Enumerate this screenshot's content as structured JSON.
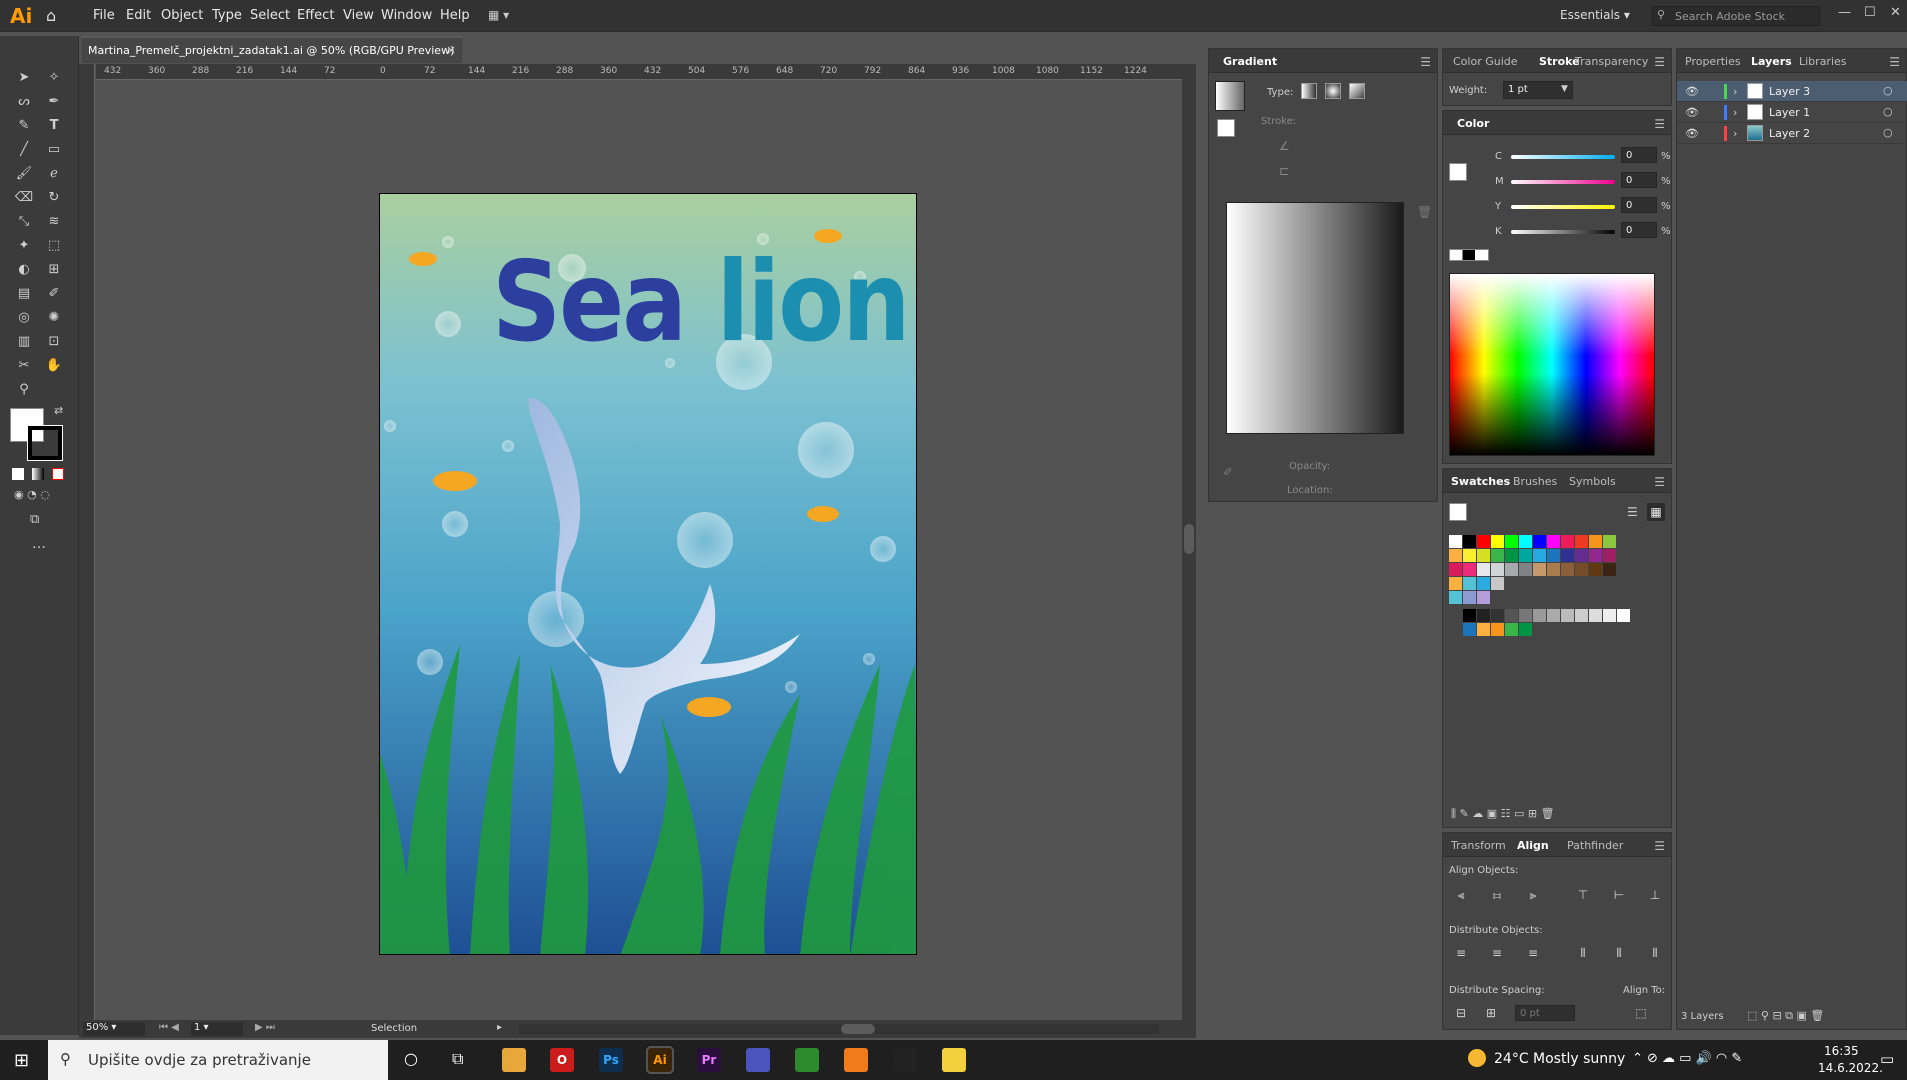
{
  "app": {
    "logo": "Ai",
    "menu": [
      "File",
      "Edit",
      "Object",
      "Type",
      "Select",
      "Effect",
      "View",
      "Window",
      "Help"
    ],
    "workspace": "Essentials",
    "search_placeholder": "Search Adobe Stock"
  },
  "document": {
    "tab_title": "Martina_Premelč_projektni_zadatak1.ai @ 50% (RGB/GPU Preview)",
    "close": "×"
  },
  "ruler": {
    "ticks": [
      "432",
      "360",
      "288",
      "216",
      "144",
      "72",
      "0",
      "72",
      "144",
      "216",
      "288",
      "360",
      "432",
      "504",
      "576",
      "648",
      "720",
      "792",
      "864",
      "936",
      "1008",
      "1080",
      "1152",
      "1224"
    ]
  },
  "artwork": {
    "title_part1": "Sea",
    "title_part2": "lion",
    "colors": {
      "water_top": "#a9cf9f",
      "water_mid": "#4aa3c9",
      "water_bottom": "#1e4f94",
      "seaweed": "#1f9a3e",
      "fish": "#f5a623",
      "sealion": "#d9e6f5"
    }
  },
  "status": {
    "zoom": "50%",
    "page": "1",
    "mode": "Selection"
  },
  "gradient_panel": {
    "title": "Gradient",
    "type_label": "Type:",
    "stroke_label": "Stroke:",
    "opacity_label": "Opacity:",
    "location_label": "Location:"
  },
  "stroke_panel": {
    "tabs": [
      "Color Guide",
      "Stroke",
      "Transparency"
    ],
    "weight_label": "Weight:",
    "weight_value": "1 pt"
  },
  "color_panel": {
    "title": "Color",
    "channels": [
      {
        "name": "C",
        "value": "0",
        "color": "#00aeef"
      },
      {
        "name": "M",
        "value": "0",
        "color": "#ec008c"
      },
      {
        "name": "Y",
        "value": "0",
        "color": "#fff200"
      },
      {
        "name": "K",
        "value": "0",
        "color": "#000000"
      }
    ],
    "unit": "%"
  },
  "swatches_panel": {
    "tabs": [
      "Swatches",
      "Brushes",
      "Symbols"
    ],
    "row1": [
      "#ffffff",
      "#000000",
      "#ff0000",
      "#ffff00",
      "#00ff00",
      "#00ffff",
      "#0000ff",
      "#ff00ff",
      "#ee1c5a",
      "#ee3a23",
      "#f7941d",
      "#8dc63f"
    ],
    "row2": [
      "#fbb040",
      "#f9ed32",
      "#d7df23",
      "#39b54a",
      "#009444",
      "#00a79d",
      "#27aae1",
      "#1c75bc",
      "#2e3192",
      "#662d91",
      "#92278f",
      "#9e1f63"
    ],
    "row3": [
      "#da1c5c",
      "#ee2a7b",
      "#e6e7e8",
      "#d1d3d4",
      "#a7a9ac",
      "#808285",
      "#c49a6c",
      "#a97c50",
      "#8b5e3c",
      "#754c29",
      "#603913",
      "#3c2415"
    ],
    "row4": [
      "#fbb040",
      "#56c2d6",
      "#29abe2",
      "#c8c8c8"
    ],
    "row5": [
      "#56c2d6",
      "#8c9bd4",
      "#b39ddb"
    ],
    "row6": [
      "#000000",
      "#222222",
      "#333333",
      "#555555",
      "#777777",
      "#999999",
      "#aaaaaa",
      "#bbbbbb",
      "#cccccc",
      "#dddddd",
      "#eeeeee",
      "#ffffff"
    ],
    "row7": [
      "#1b75bc",
      "#fbb040",
      "#f7941d",
      "#39b54a",
      "#009444"
    ]
  },
  "align_panel": {
    "tabs": [
      "Transform",
      "Align",
      "Pathfinder"
    ],
    "align_objects": "Align Objects:",
    "distribute_objects": "Distribute Objects:",
    "distribute_spacing": "Distribute Spacing:",
    "align_to": "Align To:",
    "spacing_value": "0 pt"
  },
  "layers_panel": {
    "tabs": [
      "Properties",
      "Layers",
      "Libraries"
    ],
    "layers": [
      {
        "name": "Layer 3",
        "color": "#4ad94a",
        "selected": true
      },
      {
        "name": "Layer 1",
        "color": "#3d7bff",
        "selected": false
      },
      {
        "name": "Layer 2",
        "color": "#ff4040",
        "selected": false
      }
    ],
    "count": "3 Layers"
  },
  "taskbar": {
    "search_placeholder": "Upišite ovdje za pretraživanje",
    "apps": [
      {
        "label": "",
        "color": "#e8a73a"
      },
      {
        "label": "O",
        "color": "#cc1b1b"
      },
      {
        "label": "Ps",
        "color": "#0f2e4d"
      },
      {
        "label": "Ai",
        "color": "#3a2407"
      },
      {
        "label": "Pr",
        "color": "#2a0e3d"
      },
      {
        "label": "",
        "color": "#4b53bc"
      },
      {
        "label": "",
        "color": "#2c8a2c"
      },
      {
        "label": "",
        "color": "#f07b1a"
      },
      {
        "label": "",
        "color": "#222222"
      },
      {
        "label": "",
        "color": "#f4d03f"
      }
    ],
    "weather": "24°C  Mostly sunny",
    "time": "16:35",
    "date": "14.6.2022."
  }
}
